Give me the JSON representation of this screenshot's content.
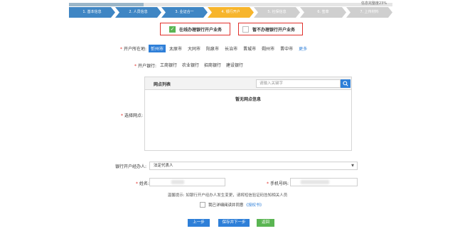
{
  "progress": {
    "label": "信息完整度23%",
    "value": 0.23
  },
  "steps": [
    {
      "label": "1. 基本信息",
      "state": "done"
    },
    {
      "label": "2. 人员信息",
      "state": "done"
    },
    {
      "label": "3. 业证合一",
      "state": "done"
    },
    {
      "label": "4. 银行开户",
      "state": "active"
    },
    {
      "label": "5. 社保信息",
      "state": "todo"
    },
    {
      "label": "6. 签章",
      "state": "todo"
    },
    {
      "label": "7. 上传材料",
      "state": "todo"
    }
  ],
  "business": {
    "online_label": "在线办理银行开户业务",
    "skip_label": "暂不办理银行开户业务"
  },
  "city": {
    "label": "开户所在地:",
    "options": [
      "忻州市",
      "太原市",
      "大同市",
      "阳泉市",
      "长治市",
      "晋城市",
      "朔州市",
      "晋中市"
    ],
    "selected": "忻州市",
    "more": "更多"
  },
  "bank": {
    "label": "开户银行:",
    "options": [
      "工商银行",
      "农业银行",
      "招商银行",
      "建设银行"
    ]
  },
  "branch": {
    "label": "选择网点:",
    "list_title": "网点列表",
    "search_placeholder": "请输入关键字",
    "empty_text": "暂无网点信息"
  },
  "agent": {
    "label": "银行开户经办人:",
    "value": "法定代表人"
  },
  "name": {
    "label": "姓名:"
  },
  "phone": {
    "label": "手机号码:"
  },
  "tip": "温馨提示: 如银行开户经办人发生变更，请将短信验证码告知相关人员",
  "agree": {
    "text": "我已详细阅读并同意",
    "link": "《授权书》"
  },
  "buttons": {
    "prev": "上一步",
    "save_next": "保存并下一步",
    "back": "返回"
  },
  "colors": {
    "accent": "#2e7fd8",
    "active_step": "#f7b52c",
    "highlight": "#e0302b",
    "success": "#5ab552"
  }
}
